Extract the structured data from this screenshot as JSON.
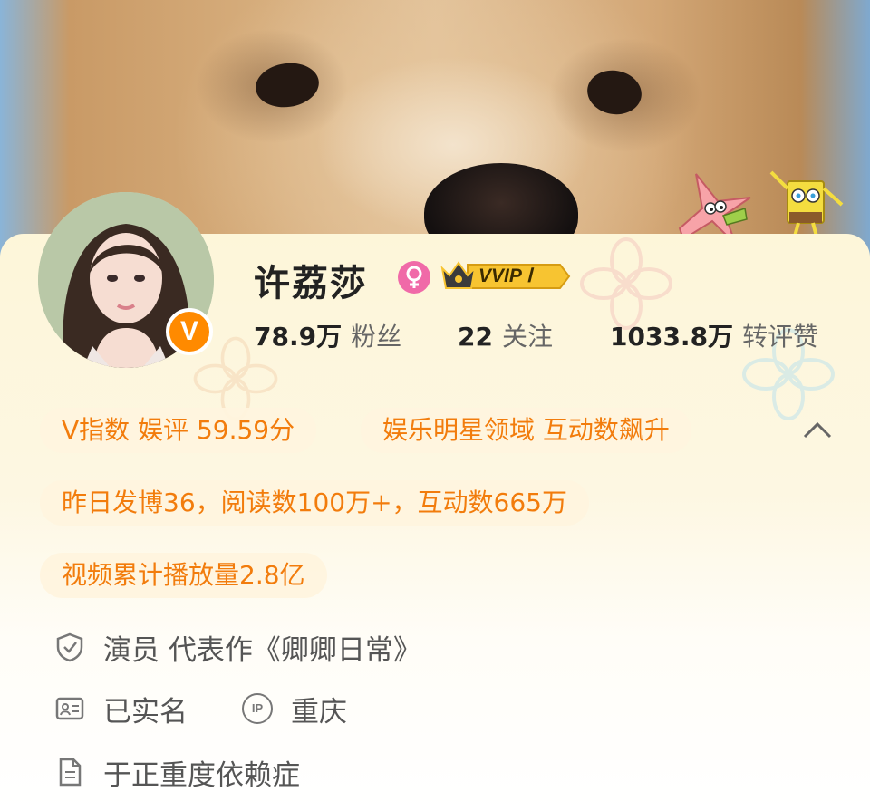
{
  "profile": {
    "name": "许荔莎",
    "vip_label": "VVIP Ⅰ",
    "verified_badge": "V"
  },
  "stats": [
    {
      "value": "78.9万",
      "label": "粉丝"
    },
    {
      "value": "22",
      "label": "关注"
    },
    {
      "value": "1033.8万",
      "label": "转评赞"
    }
  ],
  "tags": {
    "v_index": "V指数 娱评 59.59分",
    "domain": "娱乐明星领域 互动数飙升",
    "yesterday": "昨日发博36，阅读数100万+，互动数665万",
    "video": "视频累计播放量2.8亿"
  },
  "info": {
    "certification": "演员 代表作《卿卿日常》",
    "realname": "已实名",
    "ip_badge": "IP",
    "ip_location": "重庆",
    "bio": "于正重度依赖症"
  },
  "icons": {
    "gender": "female-icon",
    "crown": "crown-icon",
    "collapse": "chevron-up-icon",
    "certification": "shield-check-icon",
    "realname": "id-card-icon",
    "ip": "ip-icon",
    "bio": "document-icon"
  },
  "colors": {
    "accent_orange": "#f27c0c",
    "pill_bg": "#fff4de",
    "badge_orange": "#ff8a00",
    "gender_pink": "#f06aa8",
    "vip_gold": "#f7c431",
    "text_dark": "#222222",
    "text_grey": "#555555"
  }
}
